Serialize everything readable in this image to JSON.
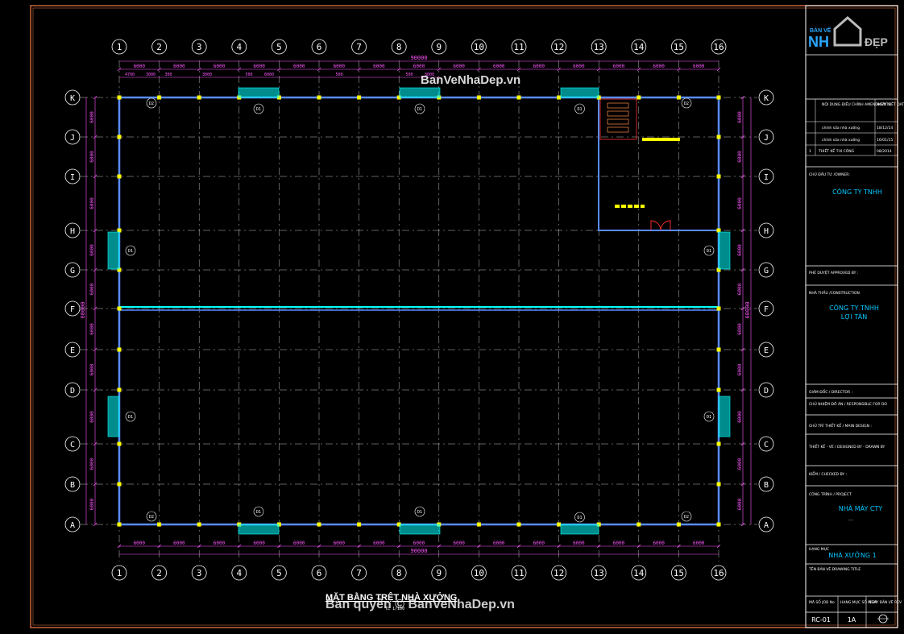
{
  "drawing": {
    "title": "MẶT BẰNG TRỆT NHÀ XƯỞNG",
    "scale_note": "TL 1/100",
    "watermark_top": "BanVeNhaDep.vn",
    "watermark_bottom": "Bản quyền © BanVeNhaDep.vn",
    "grid_columns": [
      "1",
      "2",
      "3",
      "4",
      "5",
      "6",
      "7",
      "8",
      "9",
      "10",
      "11",
      "12",
      "13",
      "14",
      "15",
      "16"
    ],
    "grid_rows": [
      "K",
      "J",
      "I",
      "H",
      "G",
      "F",
      "E",
      "D",
      "C",
      "B",
      "A"
    ],
    "col_spacing": "6000",
    "row_spacing": "6000",
    "total_width": "90000",
    "total_depth": "60000",
    "top_sub_dims": [
      "4700",
      "3000",
      "300",
      "3000",
      "500",
      "6000",
      "500",
      "500",
      "3000",
      "500"
    ],
    "door_tag": "D1",
    "window_tag": "D2"
  },
  "title_block": {
    "logo_line1": "BẢN VẼ",
    "logo_line2": "NH",
    "logo_line3": "ĐẸP",
    "rev_header_content": "NỘI DUNG ĐIỀU CHỈNH AMENDMENTS",
    "rev_header_date": "NGÀY VIẾT DATE",
    "revisions": [
      {
        "no": "",
        "content": "chỉnh sửa nhà xưởng",
        "date": "18/12/14"
      },
      {
        "no": "",
        "content": "chỉnh sửa nhà xưởng",
        "date": "16/01/15"
      },
      {
        "no": "1",
        "content": "THIẾT KẾ THI CÔNG",
        "date": "08/2014"
      }
    ],
    "owner_label": "CHỦ ĐẦU TƯ /OWNER:",
    "owner_name": "CÔNG TY TNHH",
    "approved_label": "PHÊ DUYỆT APPROVED BY :",
    "contractor_label": "NHÀ THẦU /CONSTRUCTION",
    "contractor_name_1": "CÔNG TY TNHH",
    "contractor_name_2": "LỢI TÂN",
    "director_label": "GIÁM ĐỐC / DIRECTOR :",
    "responsible_label": "CHỦ NHIỆM ĐỒ ÁN / RESPONSIBLE FOR DO",
    "design_label": "CHỦ TRÌ THIẾT KẾ / MAIN DESIGN :",
    "drawn_label": "THIẾT KẾ - VẼ / DESIGNED BY - DRAWN BY",
    "checked_label": "KIỂM / CHECKED BY :",
    "project_label": "CÔNG TRÌNH / PROJECT",
    "project_name": "NHÀ MÁY CTY",
    "project_dots": "....",
    "category_label": "HẠNG MỤC",
    "category_name": "NHÀ XƯỞNG 1",
    "sheet_title_label": "TÊN BẢN VẼ DRAWING TITLE",
    "code_label": "MÃ SỐ JOB No",
    "sheet_label": "HẠNG MỤC SỐ ITEM",
    "rev_label": "NGÀY BẢN VẼ REV",
    "code": "RC-01",
    "sheet": "1A"
  },
  "colors": {
    "frame": "#c8643c",
    "wall": "#5a8cff",
    "grid": "#ffffff",
    "bubble": "#ffffff",
    "dims": "#ff55ff",
    "cyan": "#00ffff",
    "yellow": "#ffff00",
    "red": "#ff3030",
    "tb_text": "#00c8ff"
  }
}
